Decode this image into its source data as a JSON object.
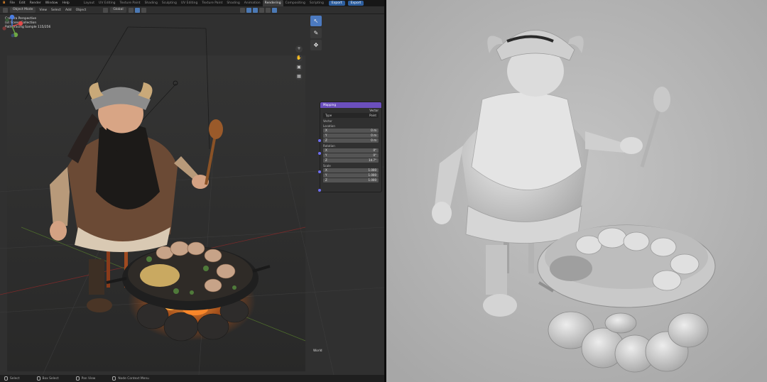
{
  "topbar": {
    "logo": "B",
    "menus": [
      "File",
      "Edit",
      "Render",
      "Window",
      "Help"
    ],
    "workspaces": [
      "Layout",
      "UV Editing",
      "Texture Paint",
      "Shading",
      "Sculpting",
      "UV Editing",
      "Texture Paint",
      "Shading",
      "Animation",
      "Rendering",
      "Compositing",
      "Scripting"
    ],
    "active_workspace_index": 9,
    "right_buttons": [
      "Export",
      "Export"
    ]
  },
  "header": {
    "mode": "Object Mode",
    "menus": [
      "View",
      "Select",
      "Add",
      "Object"
    ],
    "transform_orientation": "Global",
    "right_items": [
      "View",
      "Select",
      "Add"
    ]
  },
  "viewport": {
    "info": [
      "Camera Perspective",
      "(0) Scene Collection",
      "Path Tracing Sample 115/256"
    ],
    "world_label": "World"
  },
  "node": {
    "title": "Mapping",
    "output": "Vector",
    "type_label": "Type",
    "type_value": "Point",
    "vector_label": "Vector",
    "location": {
      "label": "Location",
      "rows": [
        {
          "axis": "X",
          "value": "0 m"
        },
        {
          "axis": "Y",
          "value": "0 m"
        },
        {
          "axis": "Z",
          "value": "0 m"
        }
      ]
    },
    "rotation": {
      "label": "Rotation",
      "rows": [
        {
          "axis": "X",
          "value": "0°"
        },
        {
          "axis": "Y",
          "value": "0°"
        },
        {
          "axis": "Z",
          "value": "14.7°"
        }
      ]
    },
    "scale": {
      "label": "Scale",
      "rows": [
        {
          "axis": "X",
          "value": "1.000"
        },
        {
          "axis": "Y",
          "value": "1.000"
        },
        {
          "axis": "Z",
          "value": "1.000"
        }
      ]
    }
  },
  "statusbar": {
    "items": [
      "Select",
      "Box Select",
      "Pan View",
      "Node Context Menu"
    ]
  },
  "colors": {
    "node_header": "#6b4fbd",
    "active_tool": "#4c7ac0",
    "export_button": "#2d5e9e",
    "fire": "#ff7a1a"
  }
}
